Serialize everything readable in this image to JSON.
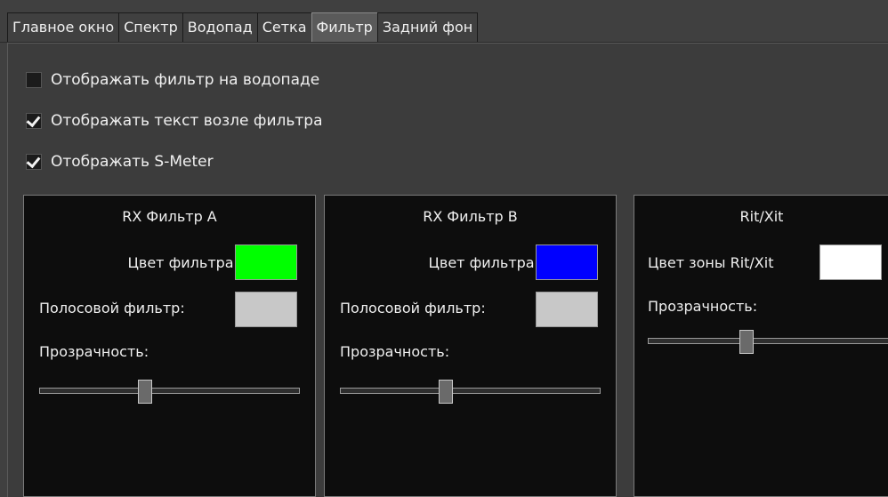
{
  "tabs": [
    {
      "label": "Главное окно"
    },
    {
      "label": "Спектр"
    },
    {
      "label": "Водопад"
    },
    {
      "label": "Сетка"
    },
    {
      "label": "Фильтр",
      "active": true
    },
    {
      "label": "Задний фон"
    }
  ],
  "options": {
    "show_filter_on_waterfall": {
      "label": "Отображать фильтр на водопаде",
      "checked": false
    },
    "show_text_near_filter": {
      "label": "Отображать текст возле фильтра",
      "checked": true
    },
    "show_smeter": {
      "label": "Отображать S-Meter",
      "checked": true
    }
  },
  "groups": {
    "rx_a": {
      "title": "RX Фильтр A",
      "filter_color_label": "Цвет фильтра:",
      "filter_color": "#00ff00",
      "bandpass_label": "Полосовой фильтр:",
      "bandpass_color": "#c8c8c8",
      "transparency_label": "Прозрачность:",
      "transparency_value": 0.4
    },
    "rx_b": {
      "title": "RX Фильтр B",
      "filter_color_label": "Цвет фильтра:",
      "filter_color": "#0000ff",
      "bandpass_label": "Полосовой фильтр:",
      "bandpass_color": "#c8c8c8",
      "transparency_label": "Прозрачность:",
      "transparency_value": 0.4
    },
    "rit_xit": {
      "title": "Rit/Xit",
      "zone_color_label": "Цвет зоны Rit/Xit",
      "zone_color": "#ffffff",
      "transparency_label": "Прозрачность:",
      "transparency_value": 0.4
    }
  }
}
